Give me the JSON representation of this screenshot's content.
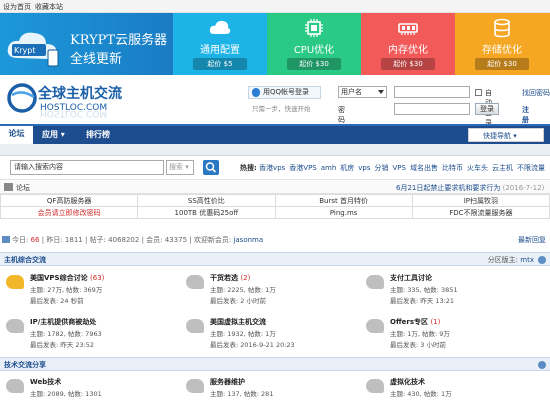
{
  "topbar": {
    "set_home": "设为首页",
    "bookmark": "收藏本站"
  },
  "banner": {
    "brand_line1": "KRYPT云服务器",
    "brand_line2": "全线更新",
    "logo_text": "Krypt",
    "tiles": [
      {
        "label": "通用配置",
        "price": "起价 $5",
        "color": "#1db3e6",
        "icon": "cloud-icon"
      },
      {
        "label": "CPU优化",
        "price": "起价 $30",
        "color": "#2ac985",
        "icon": "cpu-icon"
      },
      {
        "label": "内存优化",
        "price": "起价 $30",
        "color": "#f25a5a",
        "icon": "memory-icon"
      },
      {
        "label": "存储优化",
        "price": "起价 $30",
        "color": "#f5a623",
        "icon": "storage-icon"
      }
    ]
  },
  "header": {
    "logo_cn": "全球主机交流",
    "logo_en": "HOSTLOC.COM",
    "qq_login": "用QQ帐号登录",
    "qq_tip": "只需一步，快速开始",
    "username_select": "用户名",
    "password_label": "密码",
    "auto_login": "自动登录",
    "forgot": "找回密码",
    "login_btn": "登录",
    "register": "注册"
  },
  "nav": {
    "items": [
      "论坛",
      "应用",
      "排行榜"
    ],
    "quick": "快捷导航"
  },
  "search": {
    "placeholder": "请输入搜索内容",
    "type": "搜索",
    "hot_label": "热搜:",
    "hot": [
      "香港vps",
      "香港VPS",
      "amh",
      "机房",
      "vps",
      "分销",
      "VPS",
      "域名出售",
      "比特币",
      "火车头",
      "云主机",
      "不限流量"
    ]
  },
  "crumb": {
    "forum": "论坛",
    "notice": "6月21日起禁止要求机和要求行为",
    "notice_date": "(2016-7-12)"
  },
  "ads": [
    [
      "QF高防服务器",
      "SS高性价比",
      "Burst 首月特价",
      "IP扫属牧羽"
    ],
    [
      "会员请立即修改密码",
      "100TB 优惠码25off",
      "Ping.ms",
      "FDC不限流量服务器"
    ]
  ],
  "stats": {
    "today_label": "今日:",
    "today": "66",
    "yesterday_label": "昨日:",
    "yesterday": "1811",
    "posts_label": "帖子:",
    "posts": "4068202",
    "members_label": "会员:",
    "members": "43375",
    "newest_label": "欢迎新会员:",
    "newest": "jasonma",
    "latest": "最新回复"
  },
  "sections": [
    {
      "title": "主机综合交流",
      "moderator_label": "分区版主:",
      "moderator": "mtx",
      "forums": [
        {
          "name": "美国VPS综合讨论",
          "count": "(63)",
          "threads": "主题: 27万, 帖数: 369万",
          "last": "最后发表: 24 秒前",
          "new": true
        },
        {
          "name": "干货若选",
          "count": "(2)",
          "threads": "主题: 2225, 帖数: 1万",
          "last": "最后发表: 2 小时前",
          "new": false
        },
        {
          "name": "支付工具讨论",
          "count": "",
          "threads": "主题: 335, 帖数: 3851",
          "last": "最后发表: 昨天 13:21",
          "new": false
        },
        {
          "name": "IP/主机提供商被劫处",
          "count": "",
          "threads": "主题: 1782, 帖数: 7963",
          "last": "最后发表: 昨天 23:52",
          "new": false
        },
        {
          "name": "美国虚拟主机交流",
          "count": "",
          "threads": "主题: 1932, 帖数: 1万",
          "last": "最后发表: 2016-9-21 20:23",
          "new": false
        },
        {
          "name": "Offers专区",
          "count": "(1)",
          "threads": "主题: 1万, 帖数: 9万",
          "last": "最后发表: 3 小时前",
          "new": false
        }
      ]
    },
    {
      "title": "技术交流分享",
      "forums": [
        {
          "name": "Web技术",
          "count": "",
          "threads": "主题: 2089, 帖数: 1301",
          "last": "",
          "new": false
        },
        {
          "name": "服务器维护",
          "count": "",
          "threads": "主题: 137, 帖数: 281",
          "last": "",
          "new": false
        },
        {
          "name": "虚拟化技术",
          "count": "",
          "threads": "主题: 430, 帖数: 1万",
          "last": "",
          "new": false
        }
      ]
    }
  ]
}
